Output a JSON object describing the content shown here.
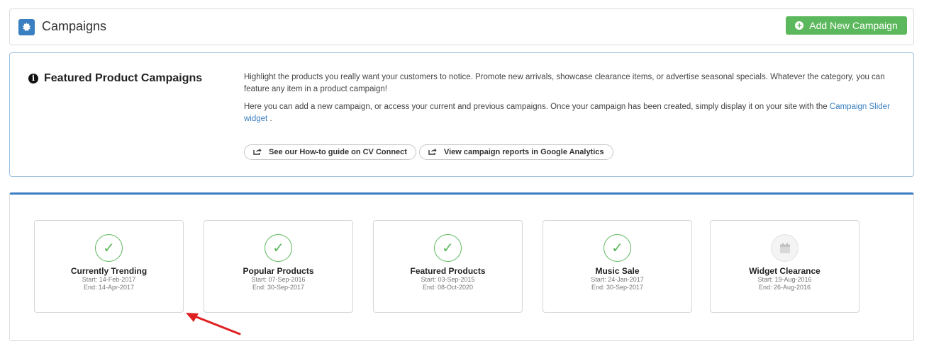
{
  "header": {
    "title": "Campaigns",
    "add_button_label": "Add New Campaign"
  },
  "info": {
    "title": "Featured Product Campaigns",
    "paragraph1": "Highlight the products you really want your customers to notice. Promote new arrivals, showcase clearance items, or advertise seasonal specials. Whatever the category, you can feature any item in a product campaign!",
    "paragraph2_prefix": "Here you can add a new campaign, or access your current and previous campaigns. Once your campaign has been created, simply display it on your site with the",
    "paragraph2_link": "Campaign Slider widget",
    "paragraph2_suffix": ".",
    "buttons": [
      {
        "label": "See our How-to guide on CV Connect"
      },
      {
        "label": "View campaign reports in Google Analytics"
      }
    ]
  },
  "campaigns": [
    {
      "name": "Currently Trending",
      "start": "Start: 14-Feb-2017",
      "end": "End: 14-Apr-2017",
      "status_icon": "check-icon"
    },
    {
      "name": "Popular Products",
      "start": "Start: 07-Sep-2016",
      "end": "End: 30-Sep-2017",
      "status_icon": "check-icon"
    },
    {
      "name": "Featured Products",
      "start": "Start: 03-Sep-2015",
      "end": "End: 08-Oct-2020",
      "status_icon": "check-icon"
    },
    {
      "name": "Music Sale",
      "start": "Start: 24-Jan-2017",
      "end": "End: 30-Sep-2017",
      "status_icon": "check-icon"
    },
    {
      "name": "Widget Clearance",
      "start": "Start: 19-Aug-2016",
      "end": "End: 26-Aug-2016",
      "status_icon": "calendar-icon"
    }
  ],
  "colors": {
    "accent": "#3a7fc1",
    "success": "#5cb85c",
    "annotation_arrow": "#e02020"
  }
}
